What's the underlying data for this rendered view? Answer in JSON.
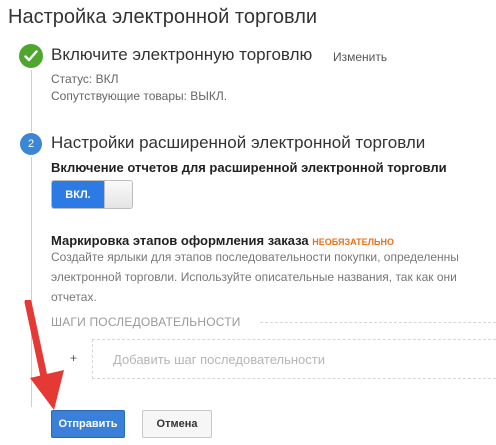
{
  "page": {
    "title": "Настройка электронной торговли"
  },
  "step1": {
    "heading": "Включите электронную торговлю",
    "edit_label": "Изменить",
    "status": "Статус: ВКЛ",
    "related_products": "Сопутствующие товары: ВЫКЛ.",
    "icon": "check-icon",
    "icon_color": "#4ea62f"
  },
  "step2": {
    "number": "2",
    "heading": "Настройки расширенной электронной торговли",
    "reports_label": "Включение отчетов для расширенной электронной торговли",
    "toggle_label": "ВКЛ.",
    "toggle_on": true,
    "checkout_label": "Маркировка этапов оформления заказа",
    "optional_label": "НЕОБЯЗАТЕЛЬНО",
    "description_lines": [
      "Создайте ярлыки для этапов последовательности покупки, определенны",
      "электронной торговли. Используйте описательные названия, так как они",
      "отчетах."
    ],
    "sequence_caption": "ШАГИ ПОСЛЕДОВАТЕЛЬНОСТИ",
    "add_step_plus": "+",
    "add_step_placeholder": "Добавить шаг последовательности",
    "accent_color": "#3b87d6"
  },
  "actions": {
    "submit_label": "Отправить",
    "cancel_label": "Отмена"
  },
  "annotation": {
    "icon": "red-arrow-icon",
    "color": "#e53935"
  }
}
